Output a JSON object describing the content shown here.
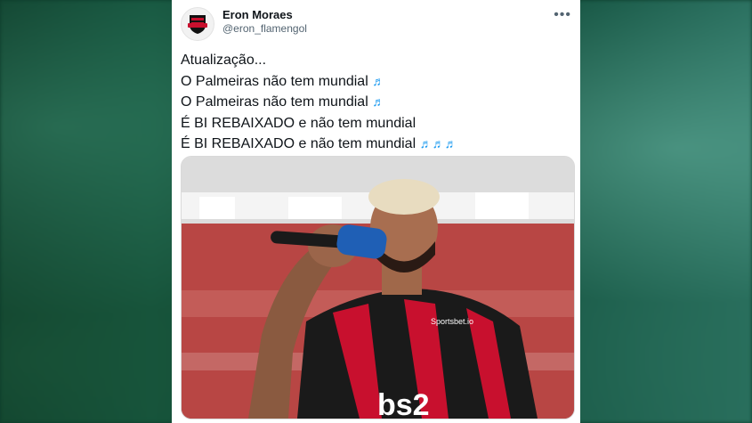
{
  "tweet": {
    "author_name": "Eron Moraes",
    "author_handle": "@eron_flamengol",
    "more_label": "•••",
    "lines": [
      {
        "text": "Atualização...",
        "notes": ""
      },
      {
        "text": "O Palmeiras não tem mundial ",
        "notes": "♬"
      },
      {
        "text": "O Palmeiras não tem mundial ",
        "notes": "♬"
      },
      {
        "text": "É BI REBAIXADO e não tem mundial",
        "notes": ""
      },
      {
        "text": "É BI REBAIXADO e não tem mundial ",
        "notes": "♬♬♬"
      }
    ]
  },
  "media": {
    "jersey_sponsor": "bs2",
    "jersey_brand": "Sportsbet.io"
  }
}
